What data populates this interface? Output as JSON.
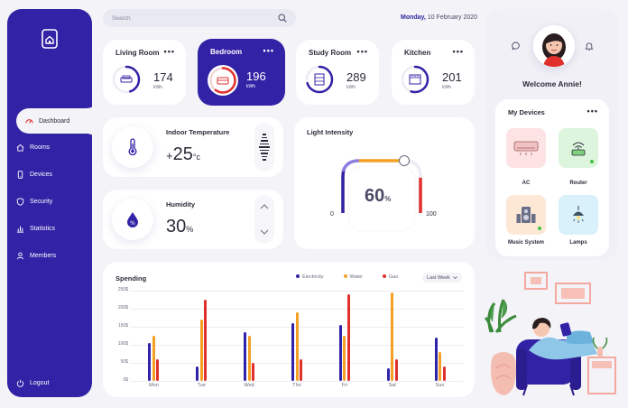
{
  "search": {
    "placeholder": "Search"
  },
  "date": {
    "weekday": "Monday,",
    "rest": " 10 February 2020"
  },
  "sidebar": {
    "items": [
      {
        "label": "Dashboard"
      },
      {
        "label": "Rooms"
      },
      {
        "label": "Devices"
      },
      {
        "label": "Security"
      },
      {
        "label": "Statistics"
      },
      {
        "label": "Members"
      }
    ],
    "logout": "Logout"
  },
  "rooms": [
    {
      "name": "Living Room",
      "value": "174",
      "unit": "kWh",
      "progress": 0.45
    },
    {
      "name": "Bedroom",
      "value": "196",
      "unit": "kWh",
      "progress": 0.6
    },
    {
      "name": "Study Room",
      "value": "289",
      "unit": "kWh",
      "progress": 0.7
    },
    {
      "name": "Kitchen",
      "value": "201",
      "unit": "kWh",
      "progress": 0.55
    }
  ],
  "menu_dots": "•••",
  "temperature": {
    "title": "Indoor Temperature",
    "sign": "+",
    "value": "25",
    "unit": "°c"
  },
  "humidity": {
    "title": "Humidity",
    "value": "30",
    "unit": "%"
  },
  "light": {
    "title": "Light Intensity",
    "value": "60",
    "unit": "%",
    "min": "0",
    "max": "100",
    "level": 0.6
  },
  "profile": {
    "welcome": "Welcome Annie!"
  },
  "devices": {
    "title": "My Devices",
    "items": [
      {
        "label": "AC",
        "color": "#fde3e3"
      },
      {
        "label": "Router",
        "color": "#dcf5dc"
      },
      {
        "label": "Music System",
        "color": "#fde8d6"
      },
      {
        "label": "Lamps",
        "color": "#d8f1fb"
      }
    ]
  },
  "spending": {
    "title": "Spending",
    "legend": [
      "Electricity",
      "Water",
      "Gas"
    ],
    "filter": "Last Week",
    "colors": {
      "electricity": "#2e22a8",
      "water": "#f4a024",
      "gas": "#e0302c"
    }
  },
  "chart_data": {
    "type": "bar",
    "categories": [
      "Mon",
      "Tue",
      "Wed",
      "Thu",
      "Fri",
      "Sat",
      "Sun"
    ],
    "ylim": [
      0,
      250
    ],
    "yticks": [
      "0$",
      "50$",
      "100$",
      "150$",
      "200$",
      "250$"
    ],
    "series": [
      {
        "name": "Electricity",
        "values": [
          105,
          40,
          135,
          160,
          155,
          35,
          120
        ]
      },
      {
        "name": "Water",
        "values": [
          125,
          170,
          125,
          190,
          125,
          245,
          80
        ]
      },
      {
        "name": "Gas",
        "values": [
          60,
          225,
          50,
          60,
          240,
          60,
          40
        ]
      }
    ]
  }
}
